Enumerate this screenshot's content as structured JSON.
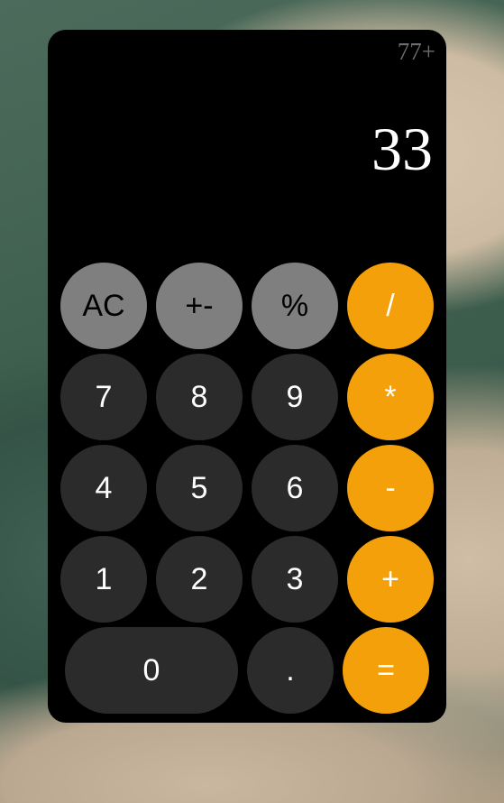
{
  "display": {
    "history": "77+",
    "value": "33"
  },
  "buttons": {
    "ac": "AC",
    "plus_minus": "+-",
    "percent": "%",
    "divide": "/",
    "seven": "7",
    "eight": "8",
    "nine": "9",
    "multiply": "*",
    "four": "4",
    "five": "5",
    "six": "6",
    "minus": "-",
    "one": "1",
    "two": "2",
    "three": "3",
    "plus": "+",
    "zero": "0",
    "decimal": ".",
    "equals": "="
  },
  "colors": {
    "body": "#000000",
    "function_key": "#7f7f7f",
    "number_key": "#2b2b2b",
    "operator_key": "#f4a00a"
  }
}
